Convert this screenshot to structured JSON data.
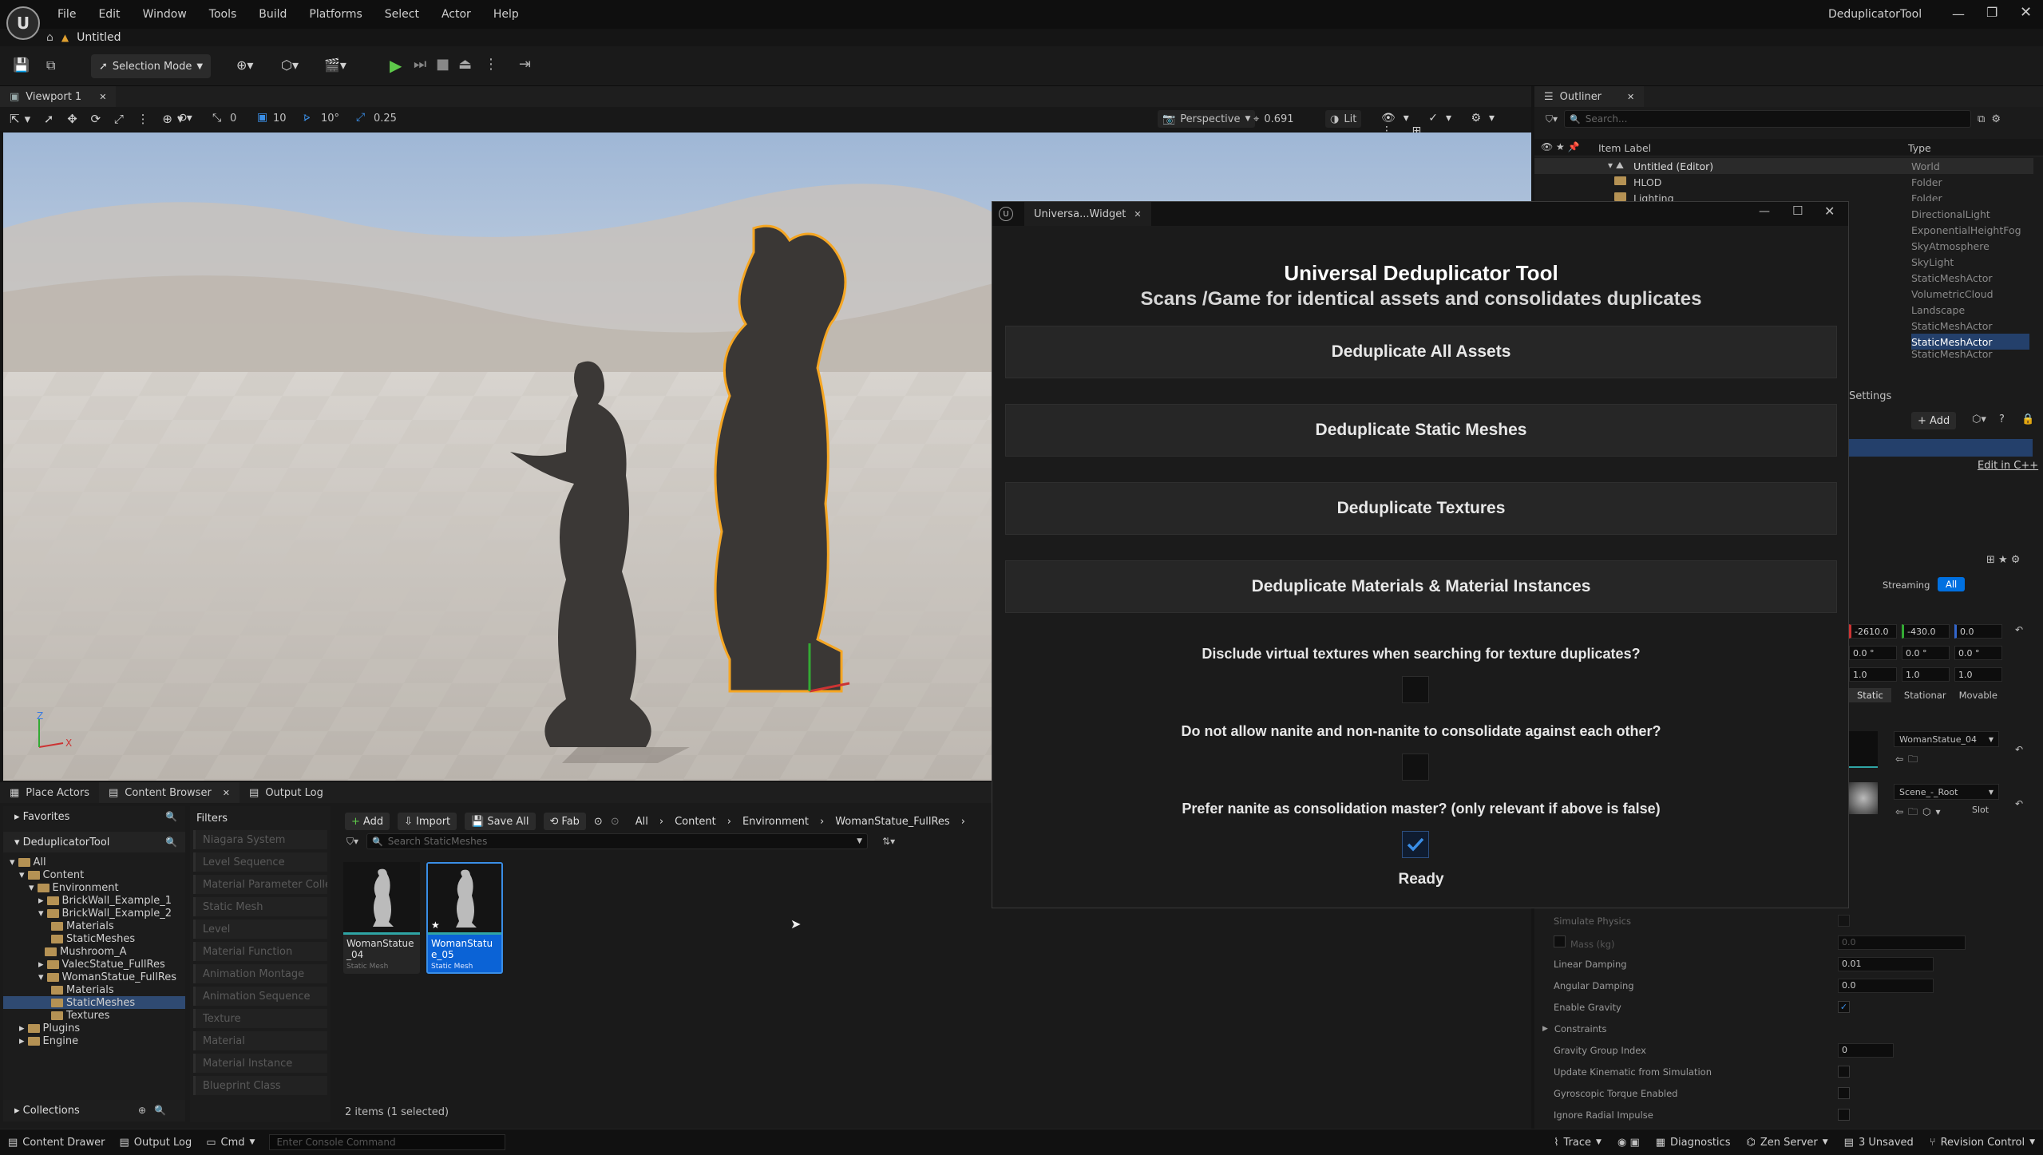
{
  "app": {
    "title": "DeduplicatorTool",
    "document_tab": "Untitled"
  },
  "menu": [
    "File",
    "Edit",
    "Window",
    "Tools",
    "Build",
    "Platforms",
    "Select",
    "Actor",
    "Help"
  ],
  "toolbar": {
    "selection_mode": "Selection Mode"
  },
  "viewport": {
    "tab_label": "Viewport 1",
    "rotate_snap": "0",
    "grid_snap": "10",
    "angle_snap": "10°",
    "scale_snap": "0.25",
    "view_mode": "Perspective",
    "camera_speed": "0.691",
    "lighting": "Lit",
    "axis_z": "Z",
    "axis_x": "X"
  },
  "outliner": {
    "tab_label": "Outliner",
    "search_placeholder": "Search...",
    "col_label": "Item Label",
    "col_type": "Type",
    "items": [
      {
        "label": "Untitled (Editor)",
        "type": "World"
      },
      {
        "label": "HLOD",
        "type": "Folder"
      },
      {
        "label": "Lighting",
        "type": "Folder"
      }
    ],
    "types_partial": [
      "DirectionalLight",
      "ExponentialHeightFog",
      "SkyAtmosphere",
      "SkyLight",
      "StaticMeshActor",
      "VolumetricCloud",
      "Landscape",
      "StaticMeshActor",
      "StaticMeshActor",
      "StaticMeshActor"
    ]
  },
  "details": {
    "settings_tab": "Settings",
    "add_label": "+ Add",
    "edit_cpp": "Edit in C++",
    "filter_streaming": "Streaming",
    "filter_all": "All",
    "location": [
      "-2610.0",
      "-430.0",
      "0.0"
    ],
    "rotation": [
      "0.0 °",
      "0.0 °",
      "0.0 °"
    ],
    "scale": [
      "1.0",
      "1.0",
      "1.0"
    ],
    "mobility": [
      "Static",
      "Stationar",
      "Movable"
    ],
    "static_mesh": "WomanStatue_04",
    "material": "Scene_-_Root",
    "slot": "Slot",
    "props": [
      {
        "label": "Simulate Physics",
        "value": ""
      },
      {
        "label": "Mass (kg)",
        "value": "0.0"
      },
      {
        "label": "Linear Damping",
        "value": "0.01"
      },
      {
        "label": "Angular Damping",
        "value": "0.0"
      },
      {
        "label": "Enable Gravity",
        "value": ""
      },
      {
        "label": "Constraints",
        "value": ""
      },
      {
        "label": "Gravity Group Index",
        "value": "0"
      },
      {
        "label": "Update Kinematic from Simulation",
        "value": ""
      },
      {
        "label": "Gyroscopic Torque Enabled",
        "value": ""
      },
      {
        "label": "Ignore Radial Impulse",
        "value": ""
      }
    ]
  },
  "widget": {
    "tab_label": "Universa...Widget",
    "title": "Universal Deduplicator Tool",
    "subtitle": "Scans /Game for identical assets and consolidates duplicates",
    "buttons": [
      "Deduplicate All Assets",
      "Deduplicate Static Meshes",
      "Deduplicate Textures",
      "Deduplicate Materials & Material Instances"
    ],
    "questions": [
      {
        "text": "Disclude virtual textures when searching for texture duplicates?",
        "checked": false
      },
      {
        "text": "Do not allow nanite and non-nanite to consolidate against each other?",
        "checked": false
      },
      {
        "text": "Prefer nanite as consolidation master? (only relevant if above is false)",
        "checked": true
      }
    ],
    "status": "Ready"
  },
  "content_browser": {
    "tabs": [
      "Place Actors",
      "Content Browser",
      "Output Log"
    ],
    "favorites": "Favorites",
    "project": "DeduplicatorTool",
    "filters_title": "Filters",
    "filters": [
      "Niagara System",
      "Level Sequence",
      "Material Parameter Collec",
      "Static Mesh",
      "Level",
      "Material Function",
      "Animation Montage",
      "Animation Sequence",
      "Texture",
      "Material",
      "Material Instance",
      "Blueprint Class"
    ],
    "add": "Add",
    "import": "Import",
    "save_all": "Save All",
    "fab": "Fab",
    "breadcrumb": [
      "All",
      "Content",
      "Environment",
      "WomanStatue_FullRes"
    ],
    "search_placeholder": "Search StaticMeshes",
    "tree": [
      {
        "label": "All",
        "depth": 0
      },
      {
        "label": "Content",
        "depth": 1
      },
      {
        "label": "Environment",
        "depth": 2
      },
      {
        "label": "BrickWall_Example_1",
        "depth": 3
      },
      {
        "label": "BrickWall_Example_2",
        "depth": 3
      },
      {
        "label": "Materials",
        "depth": 4
      },
      {
        "label": "StaticMeshes",
        "depth": 4
      },
      {
        "label": "Mushroom_A",
        "depth": 3
      },
      {
        "label": "ValecStatue_FullRes",
        "depth": 3
      },
      {
        "label": "WomanStatue_FullRes",
        "depth": 3
      },
      {
        "label": "Materials",
        "depth": 4
      },
      {
        "label": "StaticMeshes",
        "depth": 4
      },
      {
        "label": "Textures",
        "depth": 4
      },
      {
        "label": "Plugins",
        "depth": 1
      },
      {
        "label": "Engine",
        "depth": 1
      }
    ],
    "assets": [
      {
        "name": "WomanStatue_04",
        "type": "Static Mesh"
      },
      {
        "name": "WomanStatue_05",
        "type": "Static Mesh"
      }
    ],
    "item_count": "2 items (1 selected)",
    "collections": "Collections"
  },
  "statusbar": {
    "content_drawer": "Content Drawer",
    "output_log": "Output Log",
    "cmd": "Cmd",
    "console_placeholder": "Enter Console Command",
    "trace": "Trace",
    "diagnostics": "Diagnostics",
    "zen": "Zen Server",
    "unsaved": "3 Unsaved",
    "revision": "Revision Control"
  },
  "colors": {
    "accent": "#0070e0",
    "selection_outline": "#f5a623",
    "folder": "#b59254"
  }
}
